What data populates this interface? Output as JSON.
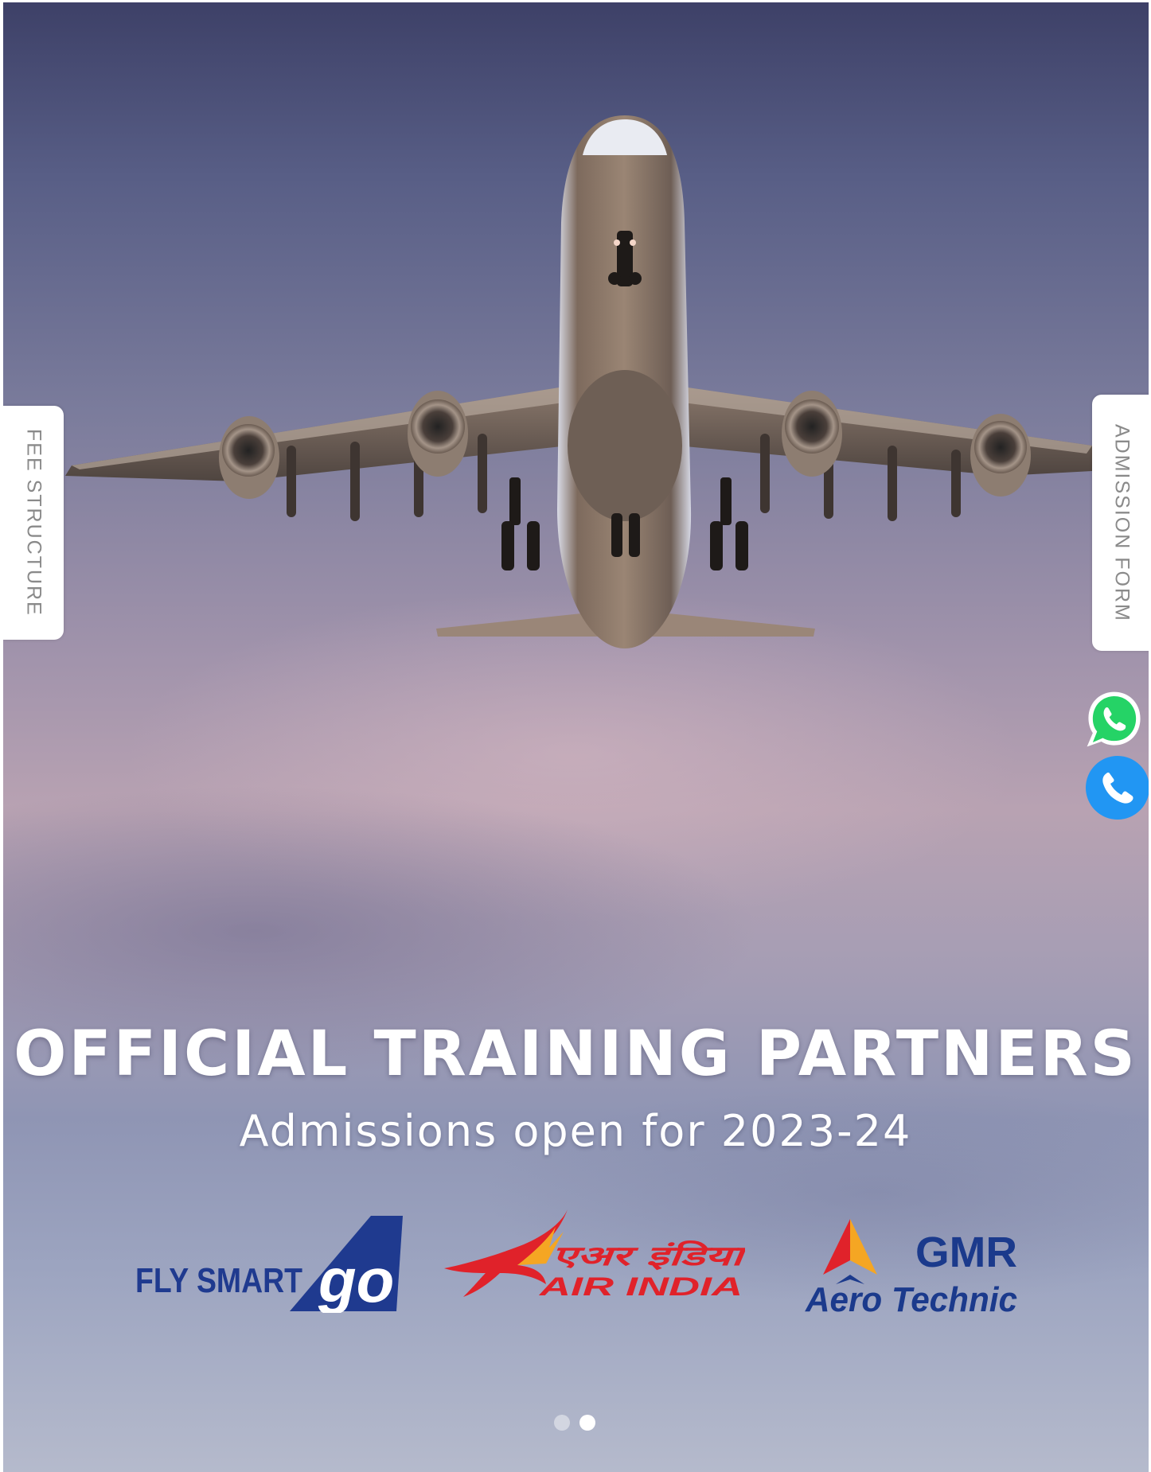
{
  "side_tabs": {
    "fee_structure": "FEE STRUCTURE",
    "admission_form": "ADMISSION FORM"
  },
  "contact_buttons": {
    "whatsapp_icon": "whatsapp-icon",
    "phone_icon": "phone-icon",
    "whatsapp_color": "#25d366",
    "phone_color": "#2196f3"
  },
  "hero": {
    "headline": "OFFICIAL TRAINING PARTNERS",
    "subline": "Admissions open for 2023-24"
  },
  "partners": {
    "go": {
      "text_fly": "FLY SMART",
      "text_brand": "go",
      "color": "#1f3a8f"
    },
    "air_india": {
      "text_hindi": "एअर इंडिया",
      "text_english": "AIR INDIA",
      "color": "#e0222a"
    },
    "gmr": {
      "text_brand": "GMR",
      "text_sub": "Aero Technic",
      "color": "#1b3a8c"
    }
  },
  "carousel": {
    "total_slides": 2,
    "active_slide": 2
  }
}
